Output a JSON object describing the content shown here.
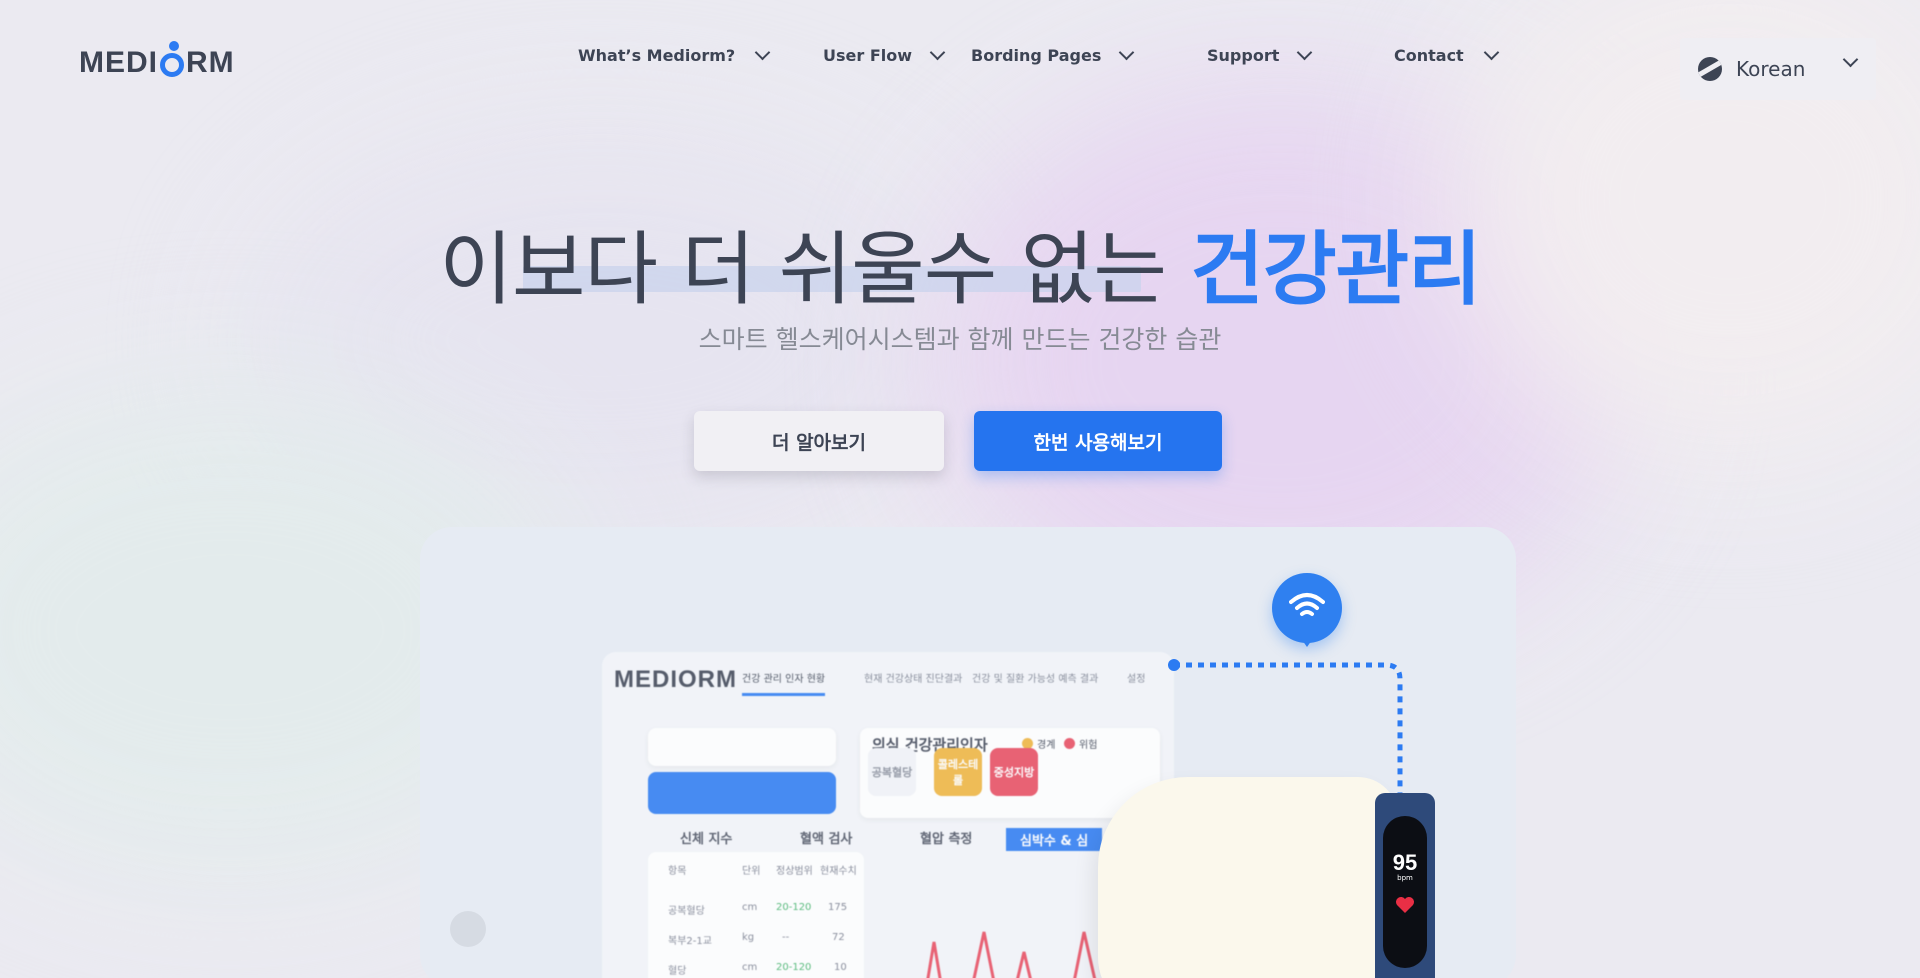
{
  "brand": {
    "logo_left": "MEDI",
    "logo_right": "RM"
  },
  "nav": {
    "items": [
      {
        "label": "What’s Mediorm?"
      },
      {
        "label": "User Flow"
      },
      {
        "label": "Bording Pages"
      },
      {
        "label": "Support"
      },
      {
        "label": "Contact"
      }
    ]
  },
  "language": {
    "selected": "Korean",
    "icon": "globe-icon"
  },
  "hero": {
    "headline_main": "이보다 더 쉬울수 없는 ",
    "headline_highlight": "건강관리",
    "subtitle": "스마트 헬스케어시스템과 함께 만드는 건강한 습관",
    "secondary_button": "더 알아보기",
    "primary_button": "한번 사용해보기"
  },
  "showcase": {
    "dashboard": {
      "logo": "MEDIORM",
      "tabs": [
        "건강 관리 인자 현황",
        "현재 건강상태 진단결과",
        "건강 및 질환 가능성 예측 결과",
        "설정"
      ],
      "section_title": "의심 건강관리인자",
      "legend": [
        {
          "label": "경계",
          "color": "#f0b43c"
        },
        {
          "label": "위험",
          "color": "#e94b5f"
        }
      ],
      "chips": [
        {
          "label": "공복혈당",
          "color": "#f2f4f8",
          "text": "#8a8f9c"
        },
        {
          "label": "콜레스테롤",
          "color": "#f0b43c",
          "text": "#ffffff"
        },
        {
          "label": "중성지방",
          "color": "#e94b5f",
          "text": "#ffffff"
        }
      ],
      "row_tabs": [
        "신체 지수",
        "혈액 검사",
        "혈압 측정",
        "심박수 & 심"
      ],
      "table_headers": [
        "항목",
        "단위",
        "정상범위",
        "현재수치"
      ],
      "table_rows": [
        [
          "공복혈당",
          "cm",
          "20-120",
          "175"
        ],
        [
          "복부2-1교",
          "kg",
          "--",
          "72"
        ],
        [
          "혈당",
          "cm",
          "20-120",
          "10"
        ]
      ]
    },
    "device": {
      "bpm_value": "95",
      "bpm_unit": "bpm"
    },
    "accent": "#2c7bf2"
  }
}
